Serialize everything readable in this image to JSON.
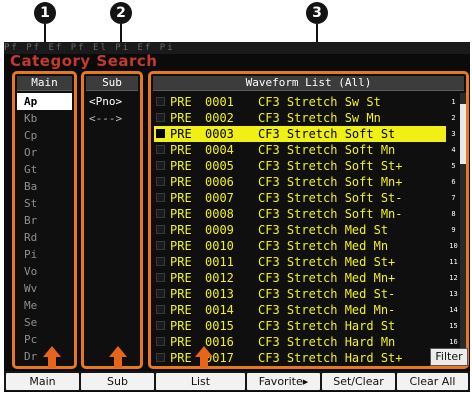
{
  "callouts": [
    "1",
    "2",
    "3"
  ],
  "window": {
    "title": "Category Search",
    "top_strip": "Pf  Pf  Ef        Pf  El  Pi  Ef  Pi"
  },
  "main": {
    "header": "Main",
    "items": [
      "Ap",
      "Kb",
      "Cp",
      "Or",
      "Gt",
      "Ba",
      "St",
      "Br",
      "Rd",
      "Pi",
      "Vo",
      "Wv",
      "Me",
      "Se",
      "Pc",
      "Dr",
      "--"
    ],
    "selected": "Ap"
  },
  "sub": {
    "header": "Sub",
    "items": [
      "<Pno>",
      "<--->"
    ],
    "selected": "<Pno>"
  },
  "waveform": {
    "header": "Waveform List (All)",
    "rows": [
      {
        "bank": "PRE",
        "number": "0001",
        "name": "CF3 Stretch Sw St",
        "index": "1"
      },
      {
        "bank": "PRE",
        "number": "0002",
        "name": "CF3 Stretch Sw Mn",
        "index": "2"
      },
      {
        "bank": "PRE",
        "number": "0003",
        "name": "CF3 Stretch Soft St",
        "index": "3"
      },
      {
        "bank": "PRE",
        "number": "0004",
        "name": "CF3 Stretch Soft Mn",
        "index": "4"
      },
      {
        "bank": "PRE",
        "number": "0005",
        "name": "CF3 Stretch Soft St+",
        "index": "5"
      },
      {
        "bank": "PRE",
        "number": "0006",
        "name": "CF3 Stretch Soft Mn+",
        "index": "6"
      },
      {
        "bank": "PRE",
        "number": "0007",
        "name": "CF3 Stretch Soft St-",
        "index": "7"
      },
      {
        "bank": "PRE",
        "number": "0008",
        "name": "CF3 Stretch Soft Mn-",
        "index": "8"
      },
      {
        "bank": "PRE",
        "number": "0009",
        "name": "CF3 Stretch Med St",
        "index": "9"
      },
      {
        "bank": "PRE",
        "number": "0010",
        "name": "CF3 Stretch Med Mn",
        "index": "10"
      },
      {
        "bank": "PRE",
        "number": "0011",
        "name": "CF3 Stretch Med St+",
        "index": "11"
      },
      {
        "bank": "PRE",
        "number": "0012",
        "name": "CF3 Stretch Med Mn+",
        "index": "12"
      },
      {
        "bank": "PRE",
        "number": "0013",
        "name": "CF3 Stretch Med St-",
        "index": "13"
      },
      {
        "bank": "PRE",
        "number": "0014",
        "name": "CF3 Stretch Med Mn-",
        "index": "14"
      },
      {
        "bank": "PRE",
        "number": "0015",
        "name": "CF3 Stretch Hard St",
        "index": "15"
      },
      {
        "bank": "PRE",
        "number": "0016",
        "name": "CF3 Stretch Hard Mn",
        "index": "16"
      },
      {
        "bank": "PRE",
        "number": "0017",
        "name": "CF3 Stretch Hard St+",
        "index": ""
      }
    ],
    "selected_row": 2,
    "scroll_position": 0.05
  },
  "filter_label": "Filter",
  "buttons": [
    {
      "label": "Main"
    },
    {
      "label": "Sub"
    },
    {
      "label": "List"
    },
    {
      "label": "Favorite▸"
    },
    {
      "label": "Set/Clear"
    },
    {
      "label": "Clear All"
    }
  ],
  "colors": {
    "accent_orange": "#e6781f",
    "title_red": "#c23a2c",
    "list_yellow": "#f2f214",
    "arrow_orange": "#e8641a"
  }
}
